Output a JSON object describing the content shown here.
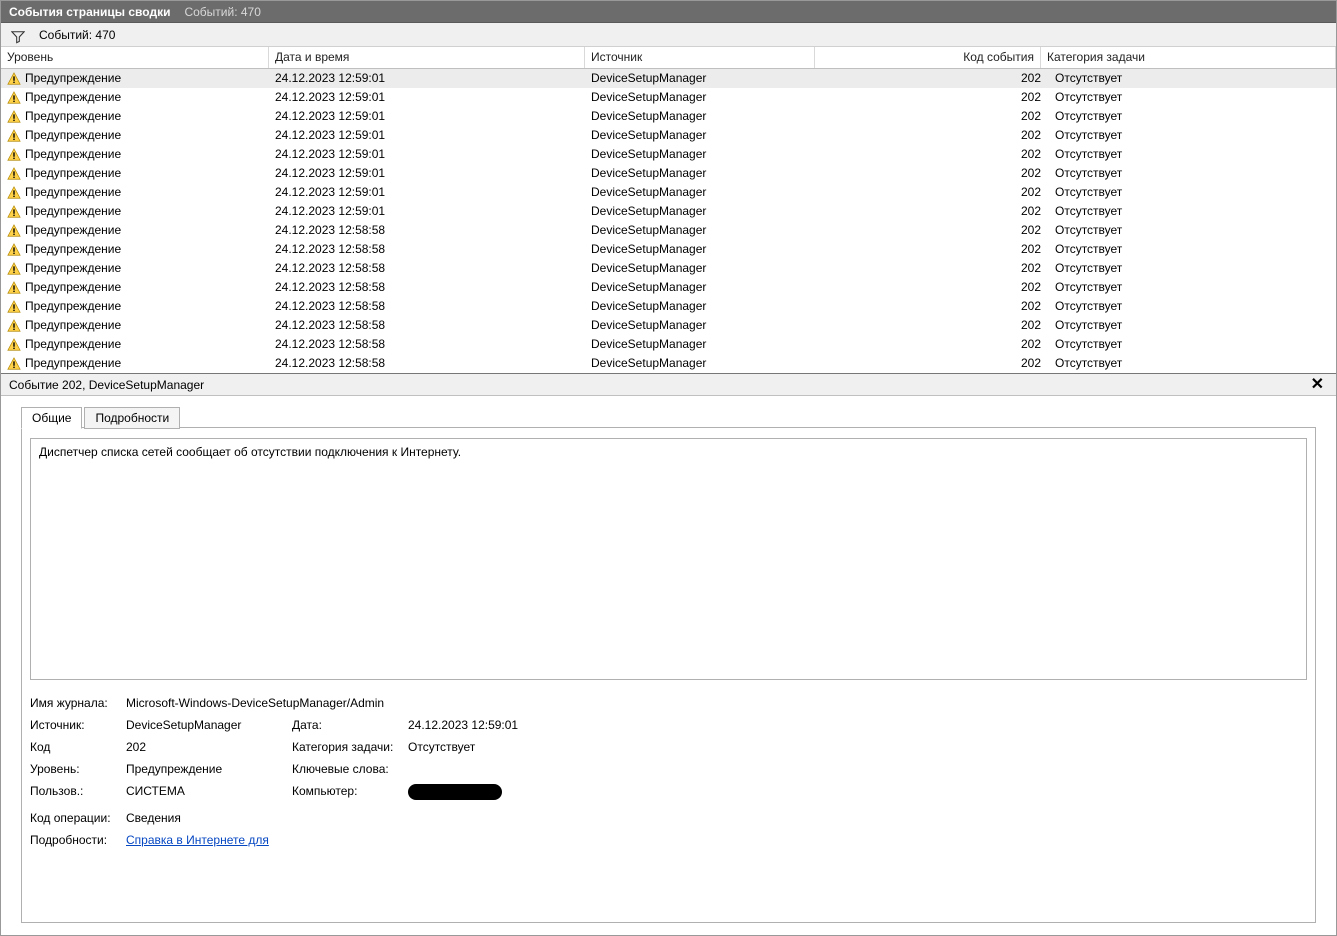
{
  "titlebar": {
    "title": "События страницы сводки",
    "count_label": "Событий: 470"
  },
  "filterbar": {
    "count_label": "Событий: 470"
  },
  "grid": {
    "columns": {
      "level": "Уровень",
      "datetime": "Дата и время",
      "source": "Источник",
      "event_id": "Код события",
      "task_category": "Категория задачи"
    },
    "rows": [
      {
        "level": "Предупреждение",
        "datetime": "24.12.2023 12:59:01",
        "source": "DeviceSetupManager",
        "event_id": "202",
        "task_category": "Отсутствует"
      },
      {
        "level": "Предупреждение",
        "datetime": "24.12.2023 12:59:01",
        "source": "DeviceSetupManager",
        "event_id": "202",
        "task_category": "Отсутствует"
      },
      {
        "level": "Предупреждение",
        "datetime": "24.12.2023 12:59:01",
        "source": "DeviceSetupManager",
        "event_id": "202",
        "task_category": "Отсутствует"
      },
      {
        "level": "Предупреждение",
        "datetime": "24.12.2023 12:59:01",
        "source": "DeviceSetupManager",
        "event_id": "202",
        "task_category": "Отсутствует"
      },
      {
        "level": "Предупреждение",
        "datetime": "24.12.2023 12:59:01",
        "source": "DeviceSetupManager",
        "event_id": "202",
        "task_category": "Отсутствует"
      },
      {
        "level": "Предупреждение",
        "datetime": "24.12.2023 12:59:01",
        "source": "DeviceSetupManager",
        "event_id": "202",
        "task_category": "Отсутствует"
      },
      {
        "level": "Предупреждение",
        "datetime": "24.12.2023 12:59:01",
        "source": "DeviceSetupManager",
        "event_id": "202",
        "task_category": "Отсутствует"
      },
      {
        "level": "Предупреждение",
        "datetime": "24.12.2023 12:59:01",
        "source": "DeviceSetupManager",
        "event_id": "202",
        "task_category": "Отсутствует"
      },
      {
        "level": "Предупреждение",
        "datetime": "24.12.2023 12:58:58",
        "source": "DeviceSetupManager",
        "event_id": "202",
        "task_category": "Отсутствует"
      },
      {
        "level": "Предупреждение",
        "datetime": "24.12.2023 12:58:58",
        "source": "DeviceSetupManager",
        "event_id": "202",
        "task_category": "Отсутствует"
      },
      {
        "level": "Предупреждение",
        "datetime": "24.12.2023 12:58:58",
        "source": "DeviceSetupManager",
        "event_id": "202",
        "task_category": "Отсутствует"
      },
      {
        "level": "Предупреждение",
        "datetime": "24.12.2023 12:58:58",
        "source": "DeviceSetupManager",
        "event_id": "202",
        "task_category": "Отсутствует"
      },
      {
        "level": "Предупреждение",
        "datetime": "24.12.2023 12:58:58",
        "source": "DeviceSetupManager",
        "event_id": "202",
        "task_category": "Отсутствует"
      },
      {
        "level": "Предупреждение",
        "datetime": "24.12.2023 12:58:58",
        "source": "DeviceSetupManager",
        "event_id": "202",
        "task_category": "Отсутствует"
      },
      {
        "level": "Предупреждение",
        "datetime": "24.12.2023 12:58:58",
        "source": "DeviceSetupManager",
        "event_id": "202",
        "task_category": "Отсутствует"
      },
      {
        "level": "Предупреждение",
        "datetime": "24.12.2023 12:58:58",
        "source": "DeviceSetupManager",
        "event_id": "202",
        "task_category": "Отсутствует"
      }
    ]
  },
  "details": {
    "header": "Событие 202, DeviceSetupManager",
    "tabs": {
      "general": "Общие",
      "details": "Подробности"
    },
    "description": "Диспетчер списка сетей сообщает об отсутствии подключения к Интернету.",
    "labels": {
      "log_name": "Имя журнала:",
      "source": "Источник:",
      "code": "Код",
      "level": "Уровень:",
      "user": "Пользов.:",
      "op_code": "Код операции:",
      "more_info": "Подробности:",
      "date": "Дата:",
      "task_category": "Категория задачи:",
      "keywords": "Ключевые слова:",
      "computer": "Компьютер:"
    },
    "values": {
      "log_name": "Microsoft-Windows-DeviceSetupManager/Admin",
      "source": "DeviceSetupManager",
      "code": "202",
      "level": "Предупреждение",
      "user": "СИСТЕМА",
      "op_code": "Сведения",
      "more_info_link": "Справка в Интернете для ",
      "date": "24.12.2023 12:59:01",
      "task_category": "Отсутствует",
      "keywords": "",
      "computer": "[redacted]"
    }
  }
}
